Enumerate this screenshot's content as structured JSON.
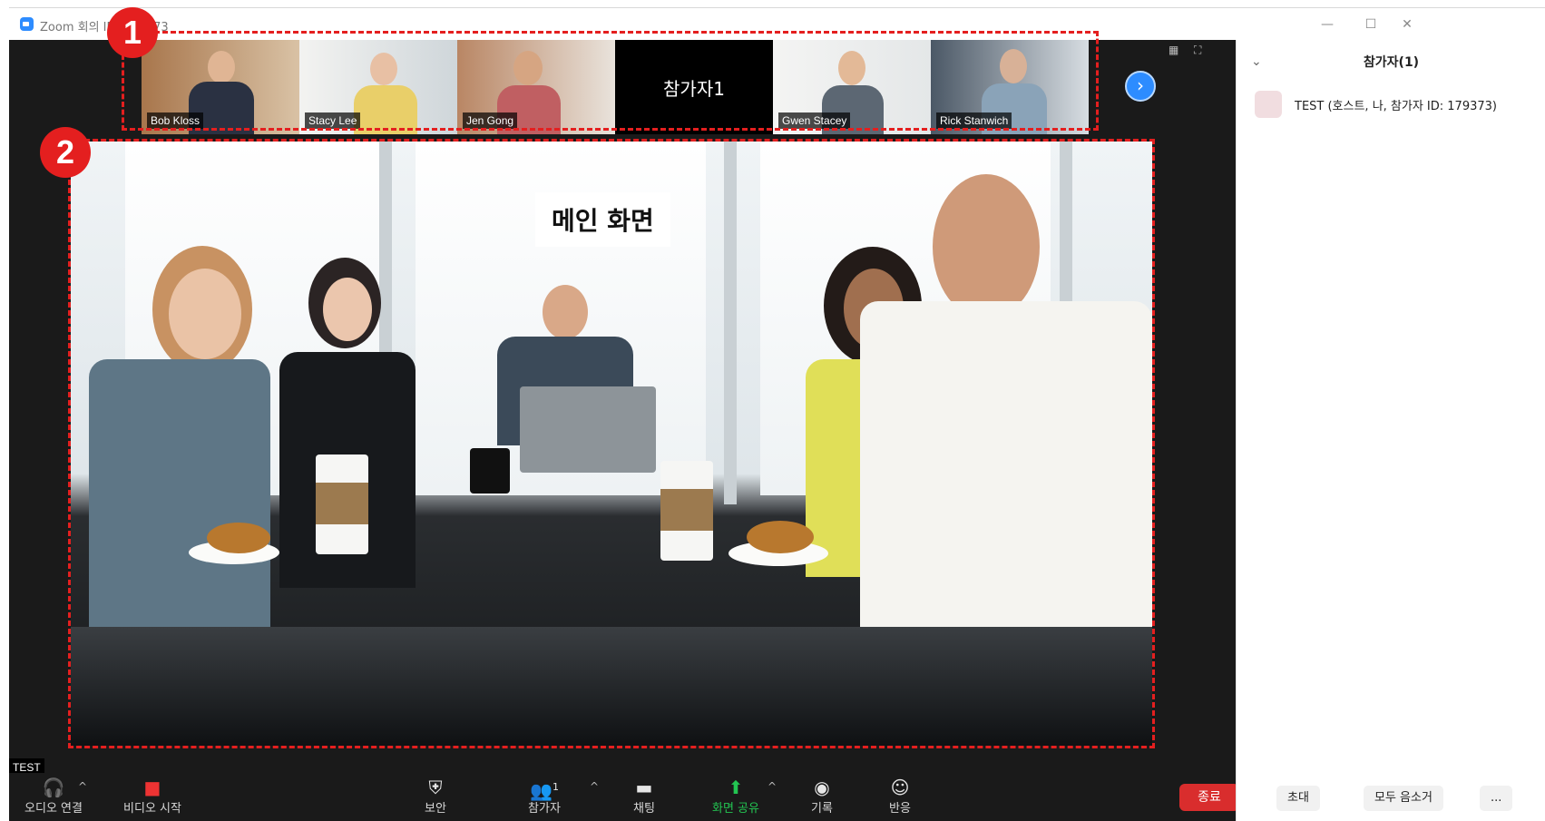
{
  "window": {
    "title": "Zoom 회의 ID: 179373",
    "minimize_glyph": "—",
    "maximize_glyph": "☐",
    "close_glyph": "✕"
  },
  "filmstrip": {
    "tiles": [
      {
        "name": "Bob Kloss"
      },
      {
        "name": "Stacy Lee"
      },
      {
        "name": "Jen Gong"
      },
      {
        "name": "참가자1"
      },
      {
        "name": "Gwen Stacey"
      },
      {
        "name": "Rick Stanwich"
      }
    ],
    "next_glyph": "›"
  },
  "annotations": {
    "badge1": "1",
    "badge2": "2",
    "main_label": "메인 화면",
    "color": "#e41f1f"
  },
  "self_view_label": "TEST",
  "toolbar": {
    "audio": "오디오 연결",
    "video": "비디오 시작",
    "security": "보안",
    "participants": "참가자",
    "participants_count": "1",
    "chat": "채팅",
    "share": "화면 공유",
    "record": "기록",
    "reactions": "반응",
    "end": "종료",
    "caret": "^"
  },
  "panel": {
    "title": "참가자(1)",
    "collapse_glyph": "⌄",
    "participants": [
      {
        "name": "TEST (호스트, 나, 참가자 ID: 179373)"
      }
    ],
    "invite": "초대",
    "mute_all": "모두 음소거",
    "more": "..."
  },
  "colors": {
    "accent": "#2d8cff",
    "end_button": "#d92d2d",
    "share_icon": "#23c552"
  }
}
